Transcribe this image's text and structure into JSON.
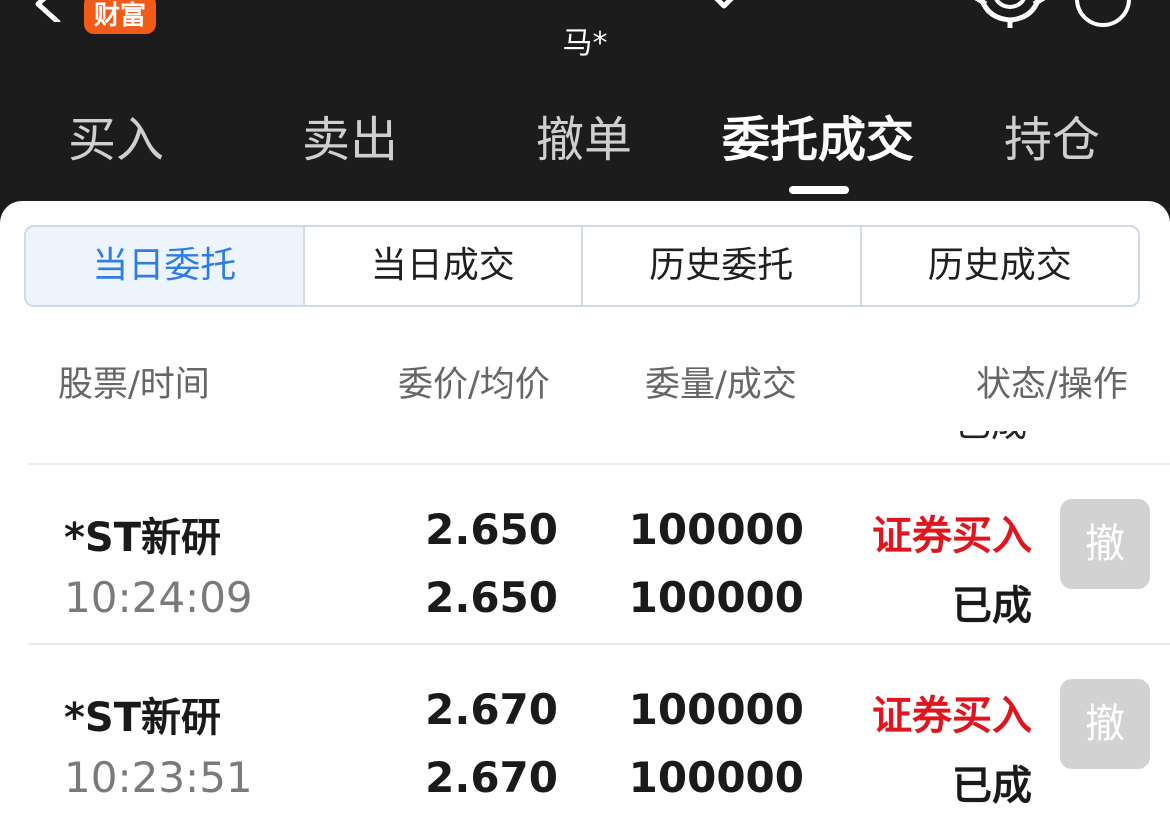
{
  "header": {
    "brand_badge": "财富",
    "account_name": "马*",
    "icons": [
      "back-icon",
      "dropdown-icon",
      "gear-icon",
      "circle-icon"
    ]
  },
  "tabs": [
    {
      "label": "买入",
      "active": false
    },
    {
      "label": "卖出",
      "active": false
    },
    {
      "label": "撤单",
      "active": false
    },
    {
      "label": "委托成交",
      "active": true
    },
    {
      "label": "持仓",
      "active": false
    }
  ],
  "segments": [
    {
      "label": "当日委托",
      "active": true
    },
    {
      "label": "当日成交",
      "active": false
    },
    {
      "label": "历史委托",
      "active": false
    },
    {
      "label": "历史成交",
      "active": false
    }
  ],
  "columns": {
    "stock_time": "股票/时间",
    "price": "委价/均价",
    "quantity": "委量/成交",
    "status_op": "状态/操作"
  },
  "partial_row_text": "已成",
  "rows": [
    {
      "name": "*ST新研",
      "time": "10:24:09",
      "order_price": "2.650",
      "avg_price": "2.650",
      "order_qty": "100000",
      "filled_qty": "100000",
      "op_type": "证券买入",
      "status": "已成",
      "cancel_label": "撤"
    },
    {
      "name": "*ST新研",
      "time": "10:23:51",
      "order_price": "2.670",
      "avg_price": "2.670",
      "order_qty": "100000",
      "filled_qty": "100000",
      "op_type": "证券买入",
      "status": "已成",
      "cancel_label": "撤"
    }
  ],
  "colors": {
    "header_bg": "#1c1c1c",
    "badge": "#f25a18",
    "accent_blue": "#2f7ee6",
    "buy_red": "#e0161e",
    "disabled_button": "#d2d2d2"
  }
}
